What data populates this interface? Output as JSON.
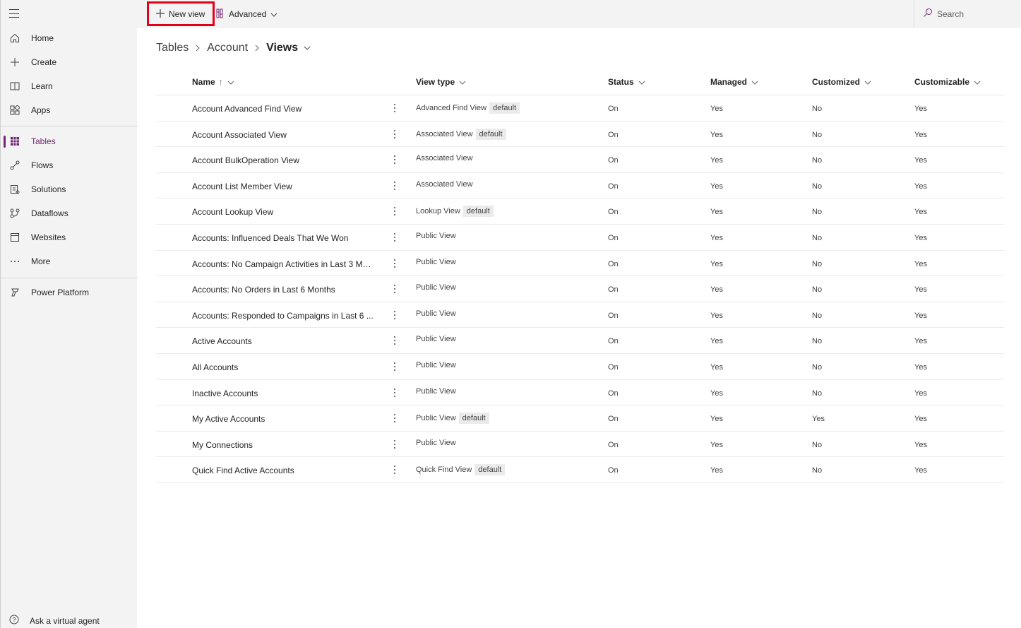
{
  "nav": {
    "menu_icon": "hamburger-icon",
    "items": [
      {
        "label": "Home",
        "icon": "home-icon"
      },
      {
        "label": "Create",
        "icon": "plus-icon"
      },
      {
        "label": "Learn",
        "icon": "book-icon"
      },
      {
        "label": "Apps",
        "icon": "apps-icon"
      },
      {
        "label": "Tables",
        "icon": "table-icon",
        "active": true
      },
      {
        "label": "Flows",
        "icon": "flow-icon"
      },
      {
        "label": "Solutions",
        "icon": "solutions-icon"
      },
      {
        "label": "Dataflows",
        "icon": "dataflow-icon"
      },
      {
        "label": "Websites",
        "icon": "website-icon"
      },
      {
        "label": "More",
        "icon": "ellipsis-icon"
      },
      {
        "label": "Power Platform",
        "icon": "power-platform-icon"
      }
    ],
    "virtual_agent": "Ask a virtual agent"
  },
  "toolbar": {
    "new_view": "New view",
    "advanced": "Advanced",
    "search": "Search"
  },
  "breadcrumb": [
    "Tables",
    "Account",
    "Views"
  ],
  "table": {
    "columns": [
      "Name",
      "View type",
      "Status",
      "Managed",
      "Customized",
      "Customizable"
    ],
    "rows": [
      {
        "name": "Account Advanced Find View",
        "view_type": "Advanced Find View",
        "badge": "default",
        "status": "On",
        "managed": "Yes",
        "customized": "No",
        "customizable": "Yes"
      },
      {
        "name": "Account Associated View",
        "view_type": "Associated View",
        "badge": "default",
        "status": "On",
        "managed": "Yes",
        "customized": "No",
        "customizable": "Yes"
      },
      {
        "name": "Account BulkOperation View",
        "view_type": "Associated View",
        "badge": "",
        "status": "On",
        "managed": "Yes",
        "customized": "No",
        "customizable": "Yes"
      },
      {
        "name": "Account List Member View",
        "view_type": "Associated View",
        "badge": "",
        "status": "On",
        "managed": "Yes",
        "customized": "No",
        "customizable": "Yes"
      },
      {
        "name": "Account Lookup View",
        "view_type": "Lookup View",
        "badge": "default",
        "status": "On",
        "managed": "Yes",
        "customized": "No",
        "customizable": "Yes"
      },
      {
        "name": "Accounts: Influenced Deals That We Won",
        "view_type": "Public View",
        "badge": "",
        "status": "On",
        "managed": "Yes",
        "customized": "No",
        "customizable": "Yes"
      },
      {
        "name": "Accounts: No Campaign Activities in Last 3 Mo...",
        "view_type": "Public View",
        "badge": "",
        "status": "On",
        "managed": "Yes",
        "customized": "No",
        "customizable": "Yes"
      },
      {
        "name": "Accounts: No Orders in Last 6 Months",
        "view_type": "Public View",
        "badge": "",
        "status": "On",
        "managed": "Yes",
        "customized": "No",
        "customizable": "Yes"
      },
      {
        "name": "Accounts: Responded to Campaigns in Last 6 ...",
        "view_type": "Public View",
        "badge": "",
        "status": "On",
        "managed": "Yes",
        "customized": "No",
        "customizable": "Yes"
      },
      {
        "name": "Active Accounts",
        "view_type": "Public View",
        "badge": "",
        "status": "On",
        "managed": "Yes",
        "customized": "No",
        "customizable": "Yes"
      },
      {
        "name": "All Accounts",
        "view_type": "Public View",
        "badge": "",
        "status": "On",
        "managed": "Yes",
        "customized": "No",
        "customizable": "Yes"
      },
      {
        "name": "Inactive Accounts",
        "view_type": "Public View",
        "badge": "",
        "status": "On",
        "managed": "Yes",
        "customized": "No",
        "customizable": "Yes"
      },
      {
        "name": "My Active Accounts",
        "view_type": "Public View",
        "badge": "default",
        "status": "On",
        "managed": "Yes",
        "customized": "Yes",
        "customizable": "Yes"
      },
      {
        "name": "My Connections",
        "view_type": "Public View",
        "badge": "",
        "status": "On",
        "managed": "Yes",
        "customized": "No",
        "customizable": "Yes"
      },
      {
        "name": "Quick Find Active Accounts",
        "view_type": "Quick Find View",
        "badge": "default",
        "status": "On",
        "managed": "Yes",
        "customized": "No",
        "customizable": "Yes"
      }
    ]
  },
  "colors": {
    "accent": "#742774",
    "highlight": "#e3001b"
  }
}
